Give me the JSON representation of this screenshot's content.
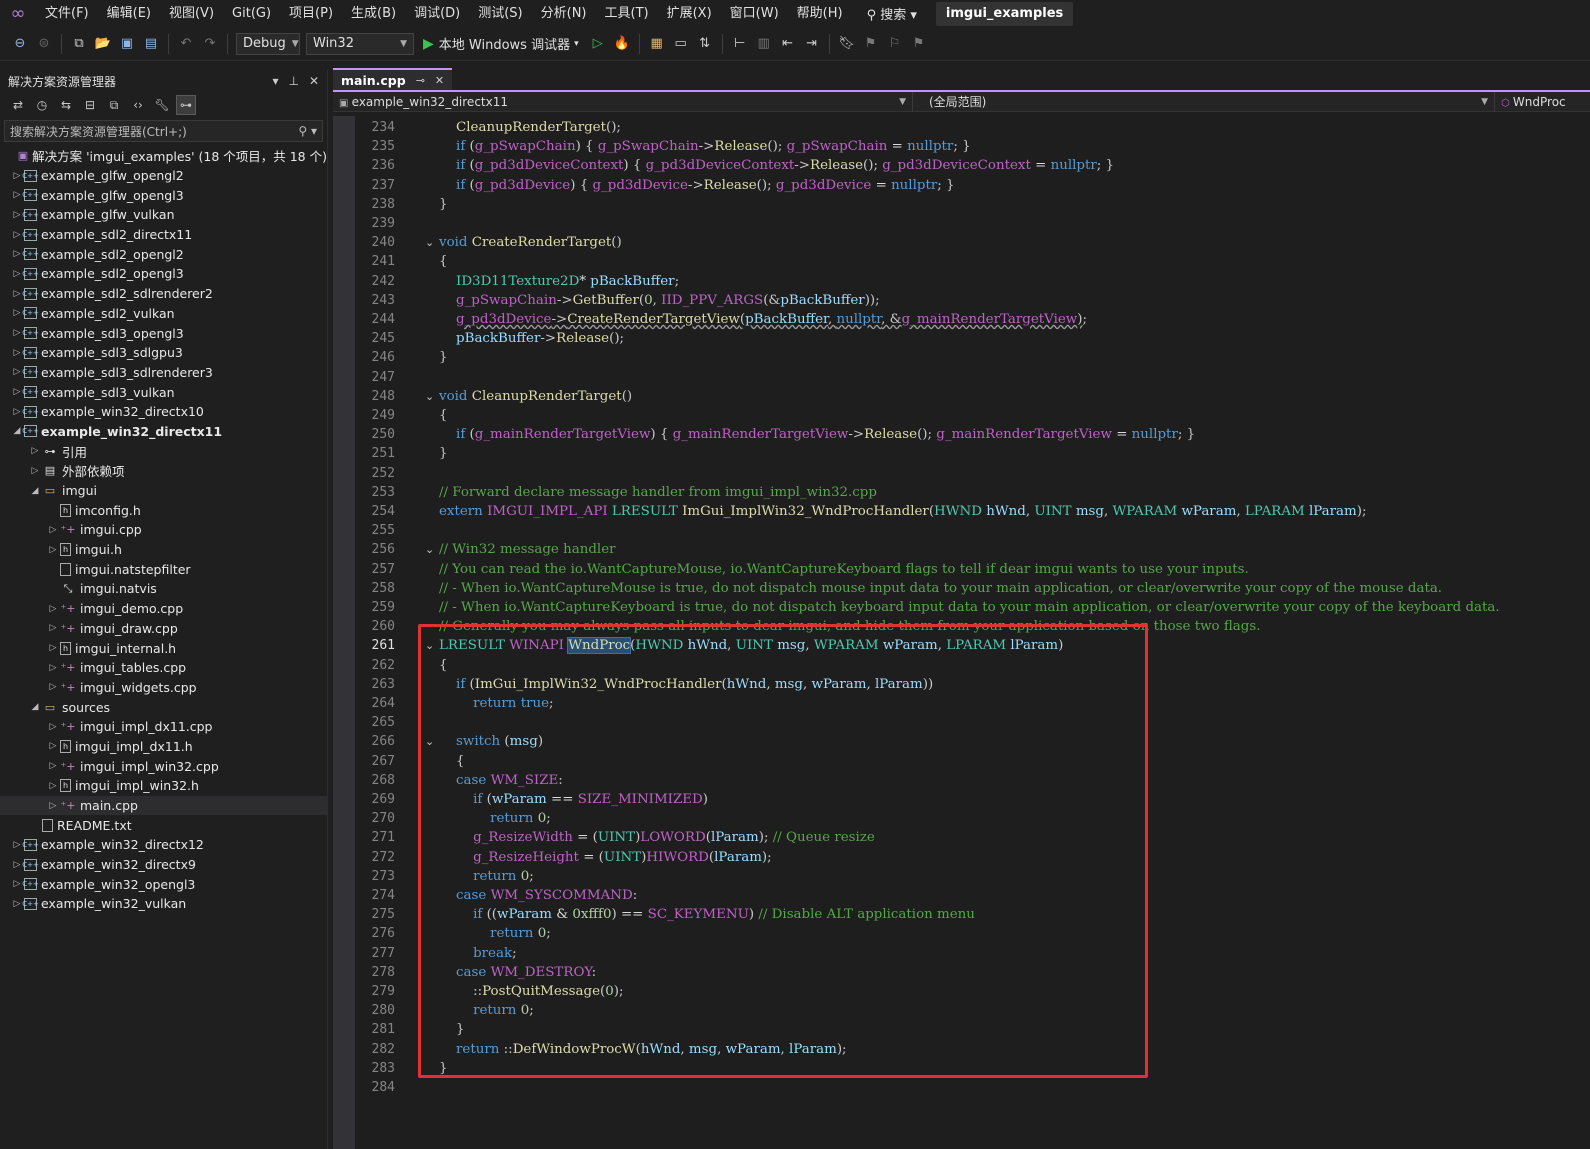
{
  "menubar": {
    "logo": "∞",
    "items": [
      "文件(F)",
      "编辑(E)",
      "视图(V)",
      "Git(G)",
      "项目(P)",
      "生成(B)",
      "调试(D)",
      "测试(S)",
      "分析(N)",
      "工具(T)",
      "扩展(X)",
      "窗口(W)",
      "帮助(H)"
    ],
    "search": "⚲ 搜索 ▾",
    "project": "imgui_examples"
  },
  "toolbar": {
    "config": "Debug",
    "platform": "Win32",
    "run_label": "本地 Windows 调试器",
    "run_arrow": "▾"
  },
  "solution_explorer": {
    "title": "解决方案资源管理器",
    "title_actions": [
      "▾",
      "⊥",
      "✕"
    ],
    "search_placeholder": "搜索解决方案资源管理器(Ctrl+;)",
    "search_icon": "⚲ ▾",
    "tree": [
      {
        "label": "解决方案 'imgui_examples' (18 个项目，共 18 个)",
        "indent": 0,
        "icon": "solution",
        "exp": ""
      },
      {
        "label": "example_glfw_opengl2",
        "indent": 0,
        "icon": "proj",
        "exp": "▷"
      },
      {
        "label": "example_glfw_opengl3",
        "indent": 0,
        "icon": "proj",
        "exp": "▷"
      },
      {
        "label": "example_glfw_vulkan",
        "indent": 0,
        "icon": "proj",
        "exp": "▷"
      },
      {
        "label": "example_sdl2_directx11",
        "indent": 0,
        "icon": "proj",
        "exp": "▷"
      },
      {
        "label": "example_sdl2_opengl2",
        "indent": 0,
        "icon": "proj",
        "exp": "▷"
      },
      {
        "label": "example_sdl2_opengl3",
        "indent": 0,
        "icon": "proj",
        "exp": "▷"
      },
      {
        "label": "example_sdl2_sdlrenderer2",
        "indent": 0,
        "icon": "proj",
        "exp": "▷"
      },
      {
        "label": "example_sdl2_vulkan",
        "indent": 0,
        "icon": "proj",
        "exp": "▷"
      },
      {
        "label": "example_sdl3_opengl3",
        "indent": 0,
        "icon": "proj",
        "exp": "▷"
      },
      {
        "label": "example_sdl3_sdlgpu3",
        "indent": 0,
        "icon": "proj",
        "exp": "▷"
      },
      {
        "label": "example_sdl3_sdlrenderer3",
        "indent": 0,
        "icon": "proj",
        "exp": "▷"
      },
      {
        "label": "example_sdl3_vulkan",
        "indent": 0,
        "icon": "proj",
        "exp": "▷"
      },
      {
        "label": "example_win32_directx10",
        "indent": 0,
        "icon": "proj",
        "exp": "▷"
      },
      {
        "label": "example_win32_directx11",
        "indent": 0,
        "icon": "proj",
        "exp": "◢",
        "bold": true
      },
      {
        "label": "引用",
        "indent": 1,
        "icon": "ref",
        "exp": "▷"
      },
      {
        "label": "外部依赖项",
        "indent": 1,
        "icon": "ext",
        "exp": "▷"
      },
      {
        "label": "imgui",
        "indent": 1,
        "icon": "folder",
        "exp": "◢"
      },
      {
        "label": "imconfig.h",
        "indent": 2,
        "icon": "h",
        "exp": ""
      },
      {
        "label": "imgui.cpp",
        "indent": 2,
        "icon": "cpp",
        "exp": "▷"
      },
      {
        "label": "imgui.h",
        "indent": 2,
        "icon": "h",
        "exp": "▷"
      },
      {
        "label": "imgui.natstepfilter",
        "indent": 2,
        "icon": "file",
        "exp": ""
      },
      {
        "label": "imgui.natvis",
        "indent": 2,
        "icon": "natvis",
        "exp": ""
      },
      {
        "label": "imgui_demo.cpp",
        "indent": 2,
        "icon": "cpp",
        "exp": "▷"
      },
      {
        "label": "imgui_draw.cpp",
        "indent": 2,
        "icon": "cpp",
        "exp": "▷"
      },
      {
        "label": "imgui_internal.h",
        "indent": 2,
        "icon": "h",
        "exp": "▷"
      },
      {
        "label": "imgui_tables.cpp",
        "indent": 2,
        "icon": "cpp",
        "exp": "▷"
      },
      {
        "label": "imgui_widgets.cpp",
        "indent": 2,
        "icon": "cpp",
        "exp": "▷"
      },
      {
        "label": "sources",
        "indent": 1,
        "icon": "folder",
        "exp": "◢"
      },
      {
        "label": "imgui_impl_dx11.cpp",
        "indent": 2,
        "icon": "cpp",
        "exp": "▷"
      },
      {
        "label": "imgui_impl_dx11.h",
        "indent": 2,
        "icon": "h",
        "exp": "▷"
      },
      {
        "label": "imgui_impl_win32.cpp",
        "indent": 2,
        "icon": "cpp",
        "exp": "▷"
      },
      {
        "label": "imgui_impl_win32.h",
        "indent": 2,
        "icon": "h",
        "exp": "▷"
      },
      {
        "label": "main.cpp",
        "indent": 2,
        "icon": "cpp",
        "exp": "▷",
        "selected": true
      },
      {
        "label": "README.txt",
        "indent": 1,
        "icon": "file",
        "exp": ""
      },
      {
        "label": "example_win32_directx12",
        "indent": 0,
        "icon": "proj",
        "exp": "▷"
      },
      {
        "label": "example_win32_directx9",
        "indent": 0,
        "icon": "proj",
        "exp": "▷"
      },
      {
        "label": "example_win32_opengl3",
        "indent": 0,
        "icon": "proj",
        "exp": "▷"
      },
      {
        "label": "example_win32_vulkan",
        "indent": 0,
        "icon": "proj",
        "exp": "▷"
      }
    ]
  },
  "editor": {
    "tab": {
      "label": "main.cpp",
      "pin": "⊸",
      "close": "✕"
    },
    "nav": {
      "scope": "example_win32_directx11",
      "symbol": "(全局范围)",
      "member": "WndProc"
    },
    "current_line": 261,
    "lines": [
      {
        "n": 234,
        "h": "    <span class='f'>CleanupRenderTarget</span><span class='p'>();</span>"
      },
      {
        "n": 235,
        "h": "    <span class='k'>if</span> <span class='p'>(</span><span class='m'>g_pSwapChain</span><span class='p'>) { </span><span class='m'>g_pSwapChain</span><span class='p'>-&gt;</span><span class='f'>Release</span><span class='p'>(); </span><span class='m'>g_pSwapChain</span> = <span class='k'>nullptr</span><span class='p'>; }</span>"
      },
      {
        "n": 236,
        "h": "    <span class='k'>if</span> <span class='p'>(</span><span class='m'>g_pd3dDeviceContext</span><span class='p'>) { </span><span class='m'>g_pd3dDeviceContext</span><span class='p'>-&gt;</span><span class='f'>Release</span><span class='p'>(); </span><span class='m'>g_pd3dDeviceContext</span> = <span class='k'>nullptr</span><span class='p'>; }</span>"
      },
      {
        "n": 237,
        "h": "    <span class='k'>if</span> <span class='p'>(</span><span class='m'>g_pd3dDevice</span><span class='p'>) { </span><span class='m'>g_pd3dDevice</span><span class='p'>-&gt;</span><span class='f'>Release</span><span class='p'>(); </span><span class='m'>g_pd3dDevice</span> = <span class='k'>nullptr</span><span class='p'>; }</span>"
      },
      {
        "n": 238,
        "h": "<span class='p'>}</span>"
      },
      {
        "n": 239,
        "h": ""
      },
      {
        "n": 240,
        "fold": "⌄",
        "h": "<span class='k'>void</span> <span class='f'>CreateRenderTarget</span><span class='p'>()</span>"
      },
      {
        "n": 241,
        "h": "<span class='p'>{</span>"
      },
      {
        "n": 242,
        "h": "    <span class='t'>ID3D11Texture2D</span>* <span class='v'>pBackBuffer</span><span class='p'>;</span>"
      },
      {
        "n": 243,
        "h": "    <span class='m'>g_pSwapChain</span><span class='p'>-&gt;</span><span class='f'>GetBuffer</span><span class='p'>(</span><span class='n'>0</span><span class='p'>, </span><span class='m'>IID_PPV_ARGS</span><span class='p'>(&amp;</span><span class='v'>pBackBuffer</span><span class='p'>));</span>"
      },
      {
        "n": 244,
        "h": "    <span class='sq'><span class='m'>g_pd3dDevice</span><span class='p'>-&gt;</span><span class='f'>CreateRenderTargetView</span><span class='p'>(</span><span class='v'>pBackBuffer</span><span class='p'>, </span><span class='k'>nullptr</span><span class='p'>, &amp;</span><span class='m'>g_mainRenderTargetView</span><span class='p'>)</span></span><span class='p'>;</span>"
      },
      {
        "n": 245,
        "h": "    <span class='v'>pBackBuffer</span><span class='p'>-&gt;</span><span class='f'>Release</span><span class='p'>();</span>"
      },
      {
        "n": 246,
        "h": "<span class='p'>}</span>"
      },
      {
        "n": 247,
        "h": ""
      },
      {
        "n": 248,
        "fold": "⌄",
        "h": "<span class='k'>void</span> <span class='f'>CleanupRenderTarget</span><span class='p'>()</span>"
      },
      {
        "n": 249,
        "h": "<span class='p'>{</span>"
      },
      {
        "n": 250,
        "h": "    <span class='k'>if</span> <span class='p'>(</span><span class='m'>g_mainRenderTargetView</span><span class='p'>) { </span><span class='m'>g_mainRenderTargetView</span><span class='p'>-&gt;</span><span class='f'>Release</span><span class='p'>(); </span><span class='m'>g_mainRenderTargetView</span> = <span class='k'>nullptr</span><span class='p'>; }</span>"
      },
      {
        "n": 251,
        "h": "<span class='p'>}</span>"
      },
      {
        "n": 252,
        "h": ""
      },
      {
        "n": 253,
        "h": "<span class='c'>// Forward declare message handler from imgui_impl_win32.cpp</span>"
      },
      {
        "n": 254,
        "h": "<span class='k'>extern</span> <span class='m'>IMGUI_IMPL_API</span> <span class='t'>LRESULT</span> <span class='f'>ImGui_ImplWin32_WndProcHandler</span><span class='p'>(</span><span class='t'>HWND</span> <span class='v'>hWnd</span><span class='p'>, </span><span class='t'>UINT</span> <span class='v'>msg</span><span class='p'>, </span><span class='t'>WPARAM</span> <span class='v'>wParam</span><span class='p'>, </span><span class='t'>LPARAM</span> <span class='v'>lParam</span><span class='p'>);</span>"
      },
      {
        "n": 255,
        "h": ""
      },
      {
        "n": 256,
        "fold": "⌄",
        "h": "<span class='c'>// Win32 message handler</span>"
      },
      {
        "n": 257,
        "h": "<span class='c'>// You can read the io.WantCaptureMouse, io.WantCaptureKeyboard flags to tell if dear imgui wants to use your inputs.</span>"
      },
      {
        "n": 258,
        "h": "<span class='c'>// - When io.WantCaptureMouse is true, do not dispatch mouse input data to your main application, or clear/overwrite your copy of the mouse data.</span>"
      },
      {
        "n": 259,
        "h": "<span class='c'>// - When io.WantCaptureKeyboard is true, do not dispatch keyboard input data to your main application, or clear/overwrite your copy of the keyboard data.</span>"
      },
      {
        "n": 260,
        "h": "<span class='c'>// Generally you may always pass all inputs to dear imgui, and hide them from your application based on those two flags.</span>"
      },
      {
        "n": 261,
        "fold": "⌄",
        "h": "<span class='t'>LRESULT</span> <span class='m'>WINAPI</span> <span class='f hl'>WndProc</span><span class='p'>(</span><span class='t'>HWND</span> <span class='v'>hWnd</span><span class='p'>, </span><span class='t'>UINT</span> <span class='v'>msg</span><span class='p'>, </span><span class='t'>WPARAM</span> <span class='v'>wParam</span><span class='p'>, </span><span class='t'>LPARAM</span> <span class='v'>lParam</span><span class='p'>)</span>"
      },
      {
        "n": 262,
        "h": "<span class='p'>{</span>"
      },
      {
        "n": 263,
        "h": "    <span class='k'>if</span> <span class='p'>(</span><span class='f'>ImGui_ImplWin32_WndProcHandler</span><span class='p'>(</span><span class='v'>hWnd</span><span class='p'>, </span><span class='v'>msg</span><span class='p'>, </span><span class='v'>wParam</span><span class='p'>, </span><span class='v'>lParam</span><span class='p'>))</span>"
      },
      {
        "n": 264,
        "h": "        <span class='k'>return</span> <span class='k'>true</span><span class='p'>;</span>"
      },
      {
        "n": 265,
        "h": ""
      },
      {
        "n": 266,
        "fold": "⌄",
        "h": "    <span class='k'>switch</span> <span class='p'>(</span><span class='v'>msg</span><span class='p'>)</span>"
      },
      {
        "n": 267,
        "h": "    <span class='p'>{</span>"
      },
      {
        "n": 268,
        "h": "    <span class='k'>case</span> <span class='m'>WM_SIZE</span><span class='p'>:</span>"
      },
      {
        "n": 269,
        "h": "        <span class='k'>if</span> <span class='p'>(</span><span class='v'>wParam</span> == <span class='m'>SIZE_MINIMIZED</span><span class='p'>)</span>"
      },
      {
        "n": 270,
        "h": "            <span class='k'>return</span> <span class='n'>0</span><span class='p'>;</span>"
      },
      {
        "n": 271,
        "h": "        <span class='m'>g_ResizeWidth</span> = <span class='p'>(</span><span class='t'>UINT</span><span class='p'>)</span><span class='m'>LOWORD</span><span class='p'>(</span><span class='v'>lParam</span><span class='p'>);</span> <span class='c'>// Queue resize</span>"
      },
      {
        "n": 272,
        "h": "        <span class='m'>g_ResizeHeight</span> = <span class='p'>(</span><span class='t'>UINT</span><span class='p'>)</span><span class='m'>HIWORD</span><span class='p'>(</span><span class='v'>lParam</span><span class='p'>);</span>"
      },
      {
        "n": 273,
        "h": "        <span class='k'>return</span> <span class='n'>0</span><span class='p'>;</span>"
      },
      {
        "n": 274,
        "h": "    <span class='k'>case</span> <span class='m'>WM_SYSCOMMAND</span><span class='p'>:</span>"
      },
      {
        "n": 275,
        "h": "        <span class='k'>if</span> <span class='p'>((</span><span class='v'>wParam</span> &amp; <span class='n'>0xfff0</span><span class='p'>)</span> == <span class='m'>SC_KEYMENU</span><span class='p'>)</span> <span class='c'>// Disable ALT application menu</span>"
      },
      {
        "n": 276,
        "h": "            <span class='k'>return</span> <span class='n'>0</span><span class='p'>;</span>"
      },
      {
        "n": 277,
        "h": "        <span class='k'>break</span><span class='p'>;</span>"
      },
      {
        "n": 278,
        "h": "    <span class='k'>case</span> <span class='m'>WM_DESTROY</span><span class='p'>:</span>"
      },
      {
        "n": 279,
        "h": "        <span class='p'>::</span><span class='f'>PostQuitMessage</span><span class='p'>(</span><span class='n'>0</span><span class='p'>);</span>"
      },
      {
        "n": 280,
        "h": "        <span class='k'>return</span> <span class='n'>0</span><span class='p'>;</span>"
      },
      {
        "n": 281,
        "h": "    <span class='p'>}</span>"
      },
      {
        "n": 282,
        "h": "    <span class='k'>return</span> <span class='p'>::</span><span class='f'>DefWindowProcW</span><span class='p'>(</span><span class='v'>hWnd</span><span class='p'>, </span><span class='v'>msg</span><span class='p'>, </span><span class='v'>wParam</span><span class='p'>, </span><span class='v'>lParam</span><span class='p'>);</span>"
      },
      {
        "n": 283,
        "h": "<span class='p'>}</span>"
      },
      {
        "n": 284,
        "h": ""
      }
    ]
  },
  "colors": {
    "accent": "#c293ff",
    "highlight_box": "#e03232",
    "keyword": "#569cd6",
    "type": "#4ec9b0",
    "function": "#dcdcaa",
    "macro": "#bd63c5",
    "comment": "#57a64a"
  }
}
